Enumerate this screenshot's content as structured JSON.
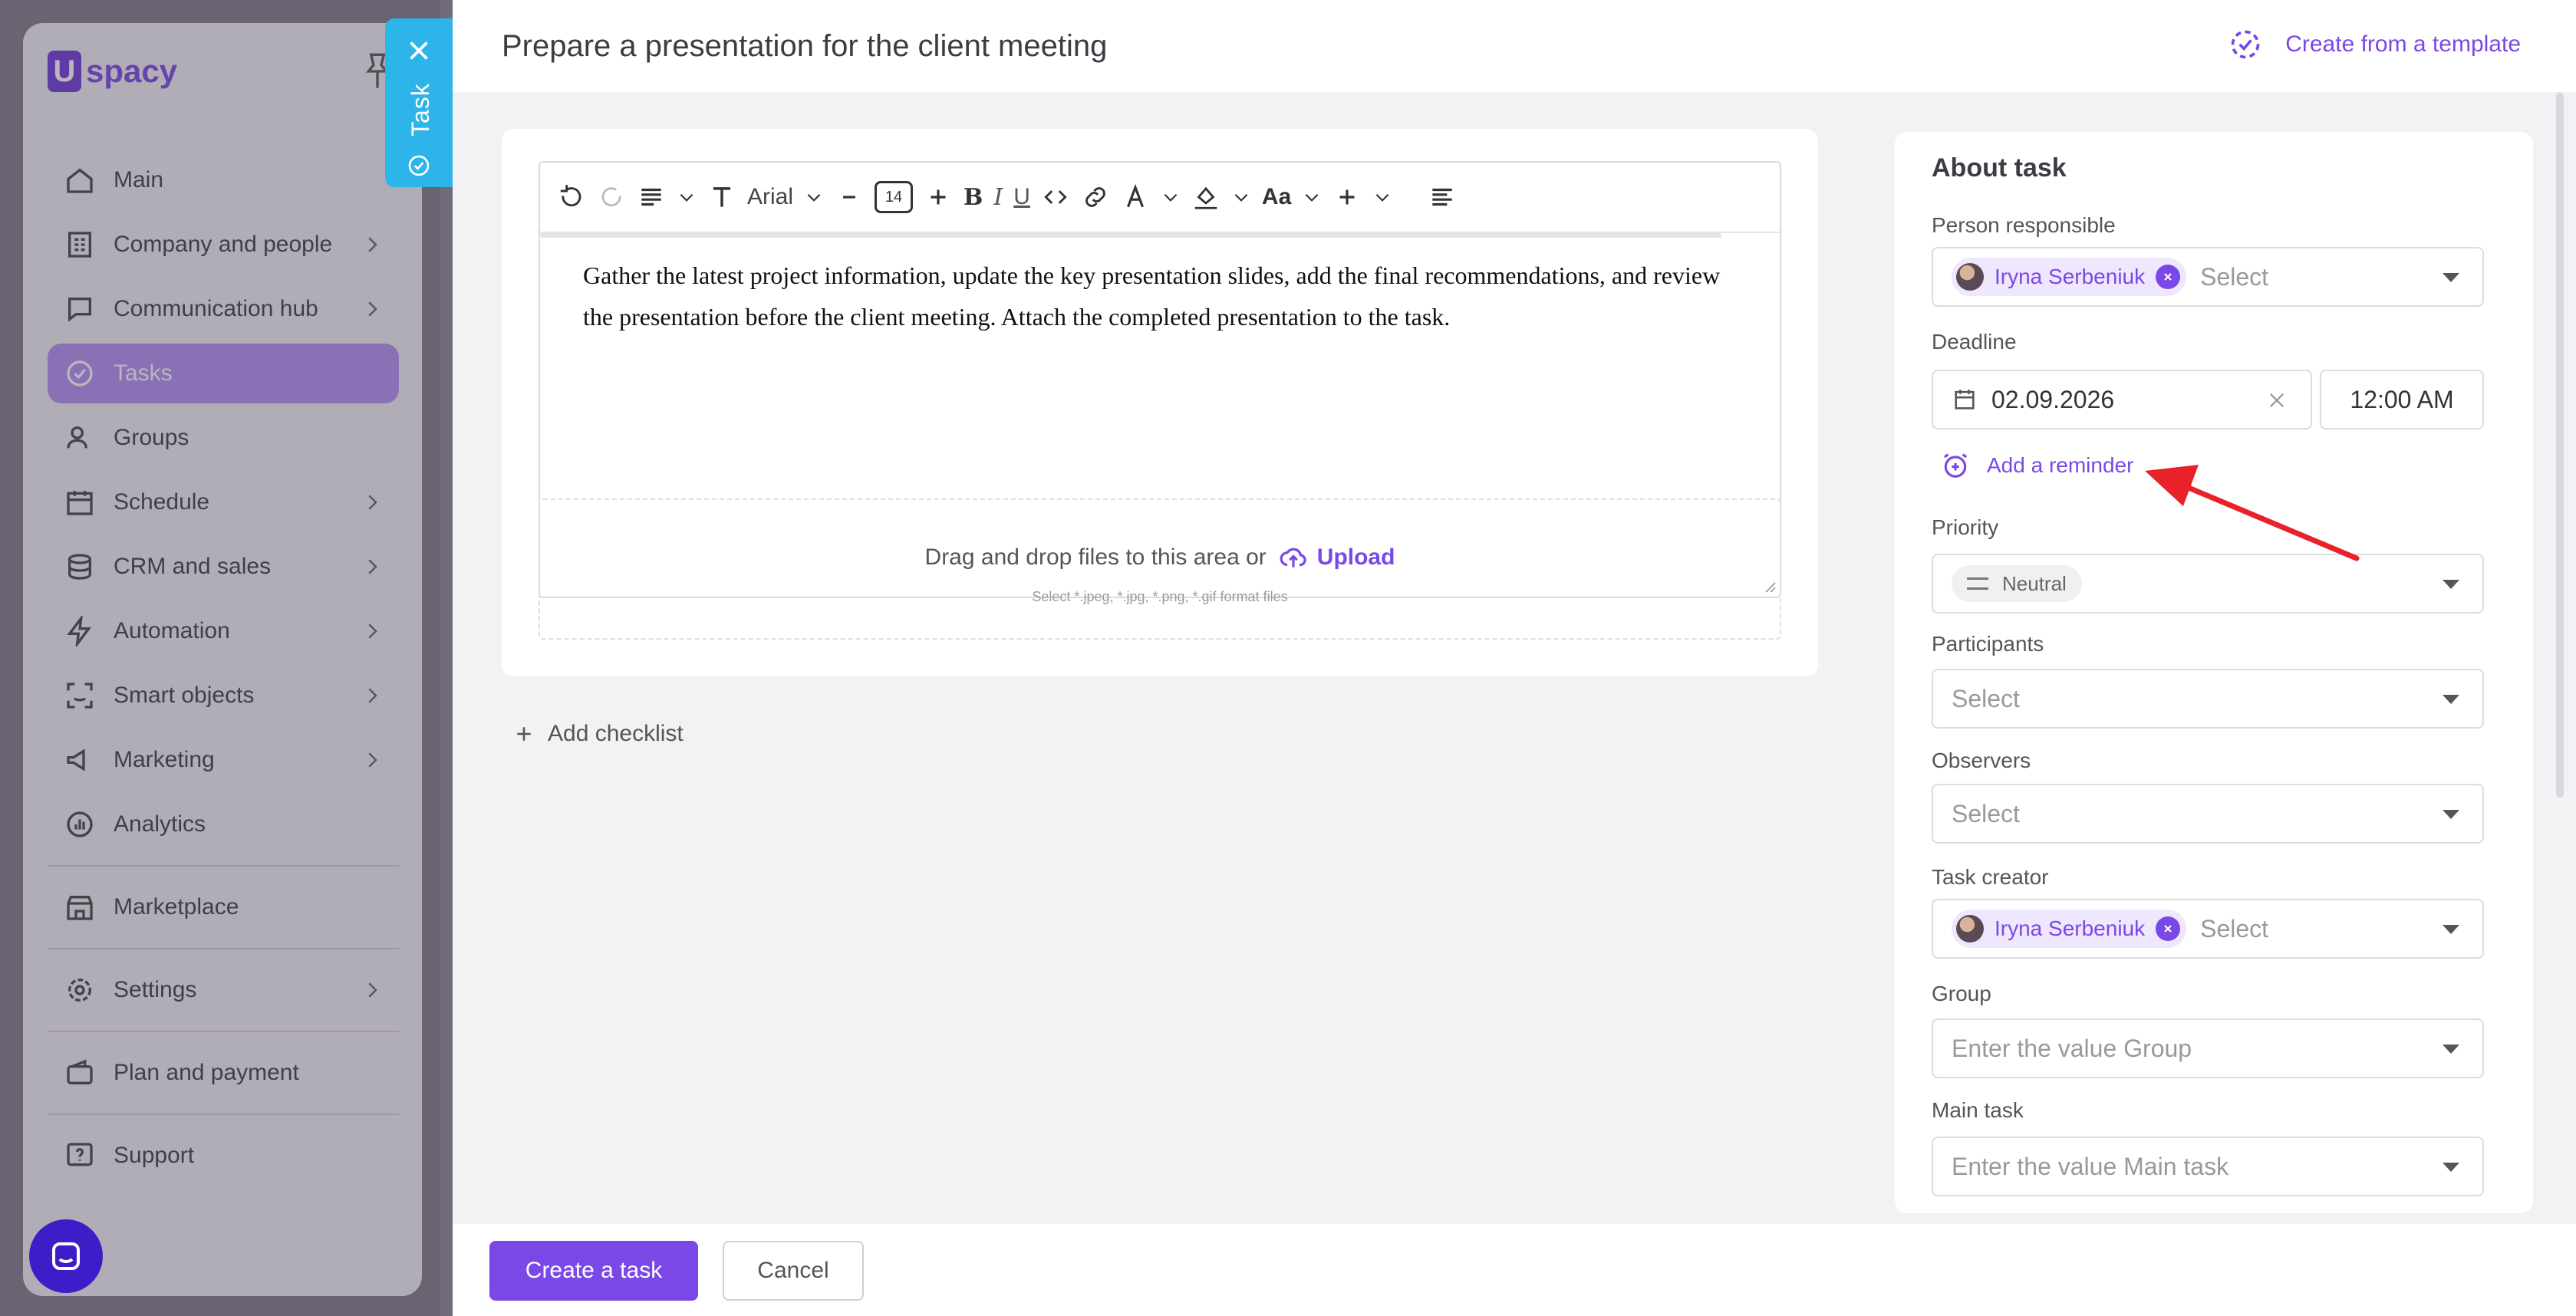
{
  "app": {
    "logo_text": "spacy",
    "logo_letter": "U"
  },
  "sidebar": {
    "items": [
      {
        "label": "Main",
        "icon": "home-icon"
      },
      {
        "label": "Company and people",
        "icon": "building-icon"
      },
      {
        "label": "Communication hub",
        "icon": "chat-icon"
      },
      {
        "label": "Tasks",
        "icon": "check-circle-icon",
        "active": true
      },
      {
        "label": "Groups",
        "icon": "users-icon"
      },
      {
        "label": "Schedule",
        "icon": "calendar-icon"
      },
      {
        "label": "CRM and sales",
        "icon": "coins-icon"
      },
      {
        "label": "Automation",
        "icon": "bolt-icon"
      },
      {
        "label": "Smart objects",
        "icon": "scan-icon"
      },
      {
        "label": "Marketing",
        "icon": "megaphone-icon"
      },
      {
        "label": "Analytics",
        "icon": "chart-icon"
      },
      {
        "label": "Marketplace",
        "icon": "store-icon"
      },
      {
        "label": "Settings",
        "icon": "gear-icon"
      },
      {
        "label": "Plan and payment",
        "icon": "wallet-icon"
      },
      {
        "label": "Support",
        "icon": "help-icon"
      }
    ]
  },
  "task_tab": {
    "label": "Task"
  },
  "header": {
    "title": "Prepare a presentation for the client meeting",
    "template_button": "Create from a template"
  },
  "editor": {
    "font": "Arial",
    "font_size": "14",
    "content": "Gather the latest project information, update the key presentation slides, add the final recommendations, and review the presentation before the client meeting. Attach the completed presentation to the task."
  },
  "dropzone": {
    "text": "Drag and drop files to this area or",
    "upload_label": "Upload",
    "hint": "Select *.jpeg, *.jpg, *.png, *.gif format files"
  },
  "checklist": {
    "add_label": "Add checklist"
  },
  "about": {
    "title": "About task",
    "person_responsible": {
      "label": "Person responsible",
      "chip": "Iryna Serbeniuk",
      "placeholder": "Select"
    },
    "deadline": {
      "label": "Deadline",
      "date": "02.09.2026",
      "time": "12:00 AM"
    },
    "reminder_label": "Add a reminder",
    "priority": {
      "label": "Priority",
      "value": "Neutral"
    },
    "participants": {
      "label": "Participants",
      "placeholder": "Select"
    },
    "observers": {
      "label": "Observers",
      "placeholder": "Select"
    },
    "task_creator": {
      "label": "Task creator",
      "chip": "Iryna Serbeniuk",
      "placeholder": "Select"
    },
    "group": {
      "label": "Group",
      "placeholder": "Enter the value Group"
    },
    "main_task": {
      "label": "Main task",
      "placeholder": "Enter the value Main task"
    }
  },
  "footer": {
    "create_label": "Create a task",
    "cancel_label": "Cancel"
  },
  "colors": {
    "accent": "#7a48e6",
    "tab": "#2db4e8",
    "annotation_arrow": "#e8222a"
  }
}
